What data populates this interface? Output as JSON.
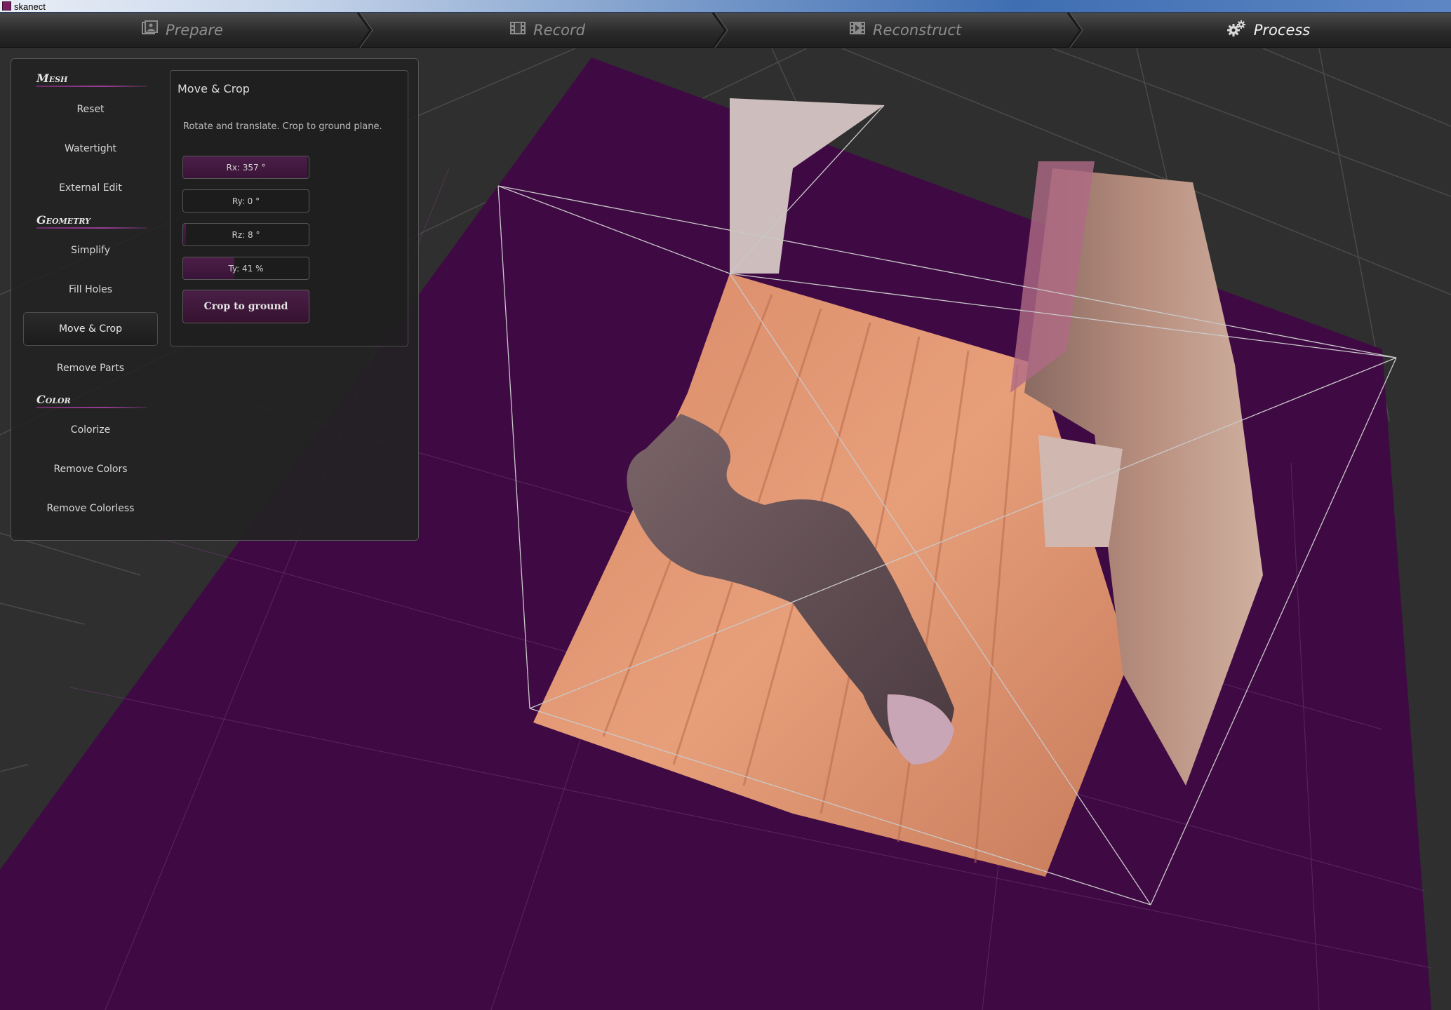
{
  "window": {
    "title": "skanect"
  },
  "workflow": {
    "steps": [
      {
        "label": "Prepare",
        "icon": "prepare-icon",
        "active": false
      },
      {
        "label": "Record",
        "icon": "film-icon",
        "active": false
      },
      {
        "label": "Reconstruct",
        "icon": "film-icon",
        "active": false
      },
      {
        "label": "Process",
        "icon": "gears-icon",
        "active": true
      }
    ]
  },
  "sidebar": {
    "mesh_title": "Mesh",
    "mesh_items": [
      "Reset",
      "Watertight",
      "External Edit"
    ],
    "geometry_title": "Geometry",
    "geometry_items": [
      "Simplify",
      "Fill Holes",
      "Move & Crop",
      "Remove Parts"
    ],
    "color_title": "Color",
    "color_items": [
      "Colorize",
      "Remove Colors",
      "Remove Colorless"
    ],
    "selected_item": "Move & Crop"
  },
  "move_crop": {
    "title": "Move & Crop",
    "description": "Rotate and translate. Crop to ground plane.",
    "rx": {
      "label": "Rx: 357 °",
      "value": 357,
      "fraction": 0.99
    },
    "ry": {
      "label": "Ry: 0 °",
      "value": 0,
      "fraction": 0.0
    },
    "rz": {
      "label": "Rz: 8 °",
      "value": 8,
      "fraction": 0.02
    },
    "ty": {
      "label": "Ty: 41 %",
      "value": 41,
      "fraction": 0.41
    },
    "crop_button": "Crop to ground"
  },
  "colors": {
    "accent": "#9b3d98",
    "ground_plane": "#3f0a44",
    "background": "#2f2f2f"
  }
}
